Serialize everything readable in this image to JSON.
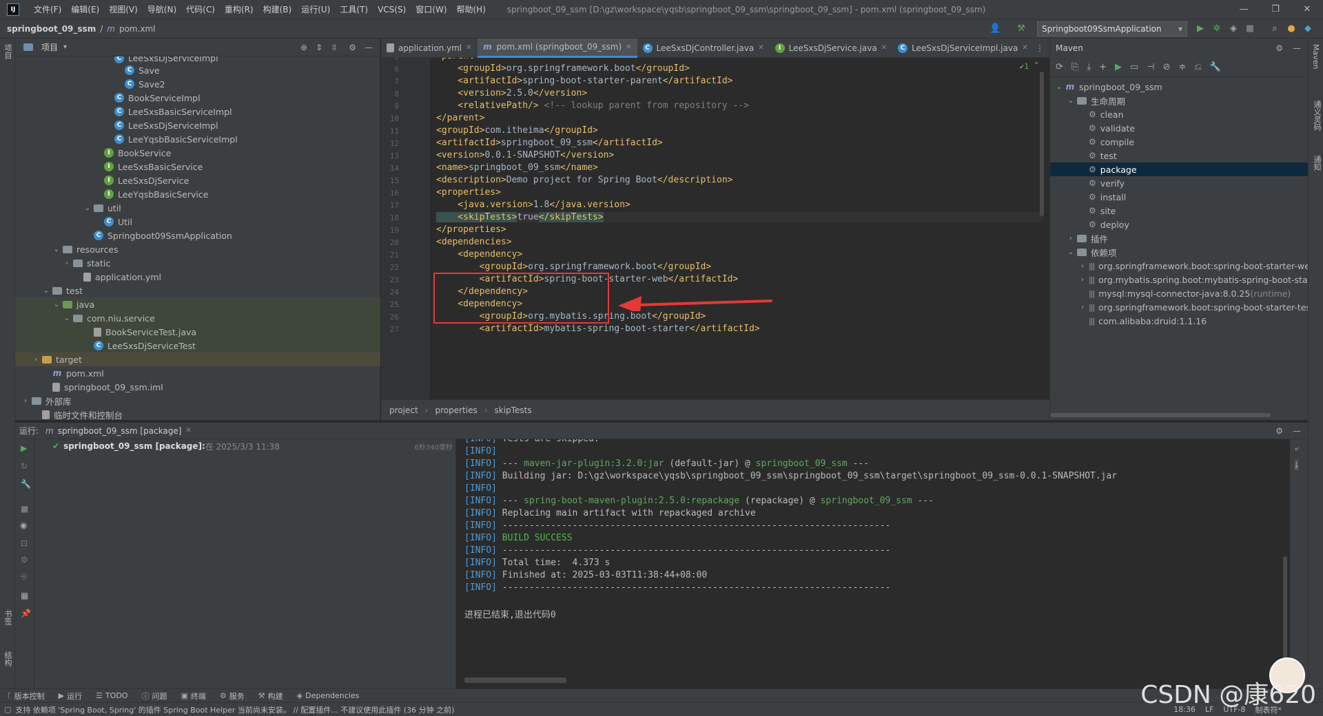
{
  "menubar": {
    "logo": "IJ",
    "items": [
      "文件(F)",
      "编辑(E)",
      "视图(V)",
      "导航(N)",
      "代码(C)",
      "重构(R)",
      "构建(B)",
      "运行(U)",
      "工具(T)",
      "VCS(S)",
      "窗口(W)",
      "帮助(H)"
    ],
    "window_title": "springboot_09_ssm [D:\\gz\\workspace\\yqsb\\springboot_09_ssm\\springboot_09_ssm] - pom.xml (springboot_09_ssm)"
  },
  "navbar": {
    "project": "springboot_09_ssm",
    "file": "pom.xml",
    "run_config": "Springboot09SsmApplication"
  },
  "left_stripe": {
    "project_label": "项目",
    "bookmarks_label": "书签",
    "structure_label": "结构"
  },
  "right_stripe": {
    "maven_label": "Maven",
    "db_label": "通义灵码",
    "notify_label": "通知"
  },
  "project_panel": {
    "title": "项目",
    "rows": [
      {
        "label": "LeeSxsDjServiceImpl",
        "indent": 8,
        "icon": "c",
        "partial": true
      },
      {
        "label": "Save",
        "indent": 9,
        "icon": "c"
      },
      {
        "label": "Save2",
        "indent": 9,
        "icon": "c"
      },
      {
        "label": "BookServiceImpl",
        "indent": 8,
        "icon": "c"
      },
      {
        "label": "LeeSxsBasicServiceImpl",
        "indent": 8,
        "icon": "c"
      },
      {
        "label": "LeeSxsDjServiceImpl",
        "indent": 8,
        "icon": "c"
      },
      {
        "label": "LeeYqsbBasicServiceImpl",
        "indent": 8,
        "icon": "c"
      },
      {
        "label": "BookService",
        "indent": 7,
        "icon": "i"
      },
      {
        "label": "LeeSxsBasicService",
        "indent": 7,
        "icon": "i"
      },
      {
        "label": "LeeSxsDjService",
        "indent": 7,
        "icon": "i"
      },
      {
        "label": "LeeYqsbBasicService",
        "indent": 7,
        "icon": "i"
      },
      {
        "label": "util",
        "indent": 6,
        "icon": "f",
        "chev": "v"
      },
      {
        "label": "Util",
        "indent": 7,
        "icon": "c"
      },
      {
        "label": "Springboot09SsmApplication",
        "indent": 6,
        "icon": "c"
      },
      {
        "label": "resources",
        "indent": 3,
        "icon": "f",
        "chev": "v"
      },
      {
        "label": "static",
        "indent": 4,
        "icon": "f",
        "chev": ">"
      },
      {
        "label": "application.yml",
        "indent": 5,
        "icon": "x"
      },
      {
        "label": "test",
        "indent": 2,
        "icon": "f",
        "chev": "v"
      },
      {
        "label": "java",
        "indent": 3,
        "icon": "fg",
        "chev": "v",
        "hl": "g"
      },
      {
        "label": "com.niu.service",
        "indent": 4,
        "icon": "f",
        "chev": "v",
        "hl": "g"
      },
      {
        "label": "BookServiceTest.java",
        "indent": 6,
        "icon": "x",
        "hl": "g"
      },
      {
        "label": "LeeSxsDjServiceTest",
        "indent": 6,
        "icon": "c",
        "hl": "g"
      },
      {
        "label": "target",
        "indent": 1,
        "icon": "fy",
        "chev": ">",
        "hl": "y"
      },
      {
        "label": "pom.xml",
        "indent": 2,
        "icon": "m"
      },
      {
        "label": "springboot_09_ssm.iml",
        "indent": 2,
        "icon": "x"
      },
      {
        "label": "外部库",
        "indent": 0,
        "icon": "lib",
        "chev": ">"
      },
      {
        "label": "临时文件和控制台",
        "indent": 1,
        "icon": "x"
      }
    ]
  },
  "tabs": [
    {
      "label": "application.yml",
      "icon": "x",
      "active": false
    },
    {
      "label": "pom.xml (springboot_09_ssm)",
      "icon": "m",
      "active": true
    },
    {
      "label": "LeeSxsDjController.java",
      "icon": "c",
      "active": false
    },
    {
      "label": "LeeSxsDjService.java",
      "icon": "i",
      "active": false
    },
    {
      "label": "LeeSxsDjServiceImpl.java",
      "icon": "c",
      "active": false
    }
  ],
  "editor": {
    "inspection": "✔1",
    "lines": [
      {
        "n": "5",
        "code": [
          [
            "tag",
            "<parent>"
          ]
        ]
      },
      {
        "n": "6",
        "code": [
          [
            "tag",
            "    <groupId>"
          ],
          [
            "txt",
            "org.springframework.boot"
          ],
          [
            "tag",
            "</groupId>"
          ]
        ]
      },
      {
        "n": "7",
        "code": [
          [
            "tag",
            "    <artifactId>"
          ],
          [
            "txt",
            "spring-boot-starter-parent"
          ],
          [
            "tag",
            "</artifactId>"
          ]
        ]
      },
      {
        "n": "8",
        "code": [
          [
            "tag",
            "    <version>"
          ],
          [
            "txt",
            "2.5.0"
          ],
          [
            "tag",
            "</version>"
          ]
        ]
      },
      {
        "n": "9",
        "code": [
          [
            "tag",
            "    <relativePath/>"
          ],
          [
            "cmt",
            " <!-- lookup parent from repository -->"
          ]
        ]
      },
      {
        "n": "10",
        "code": [
          [
            "tag",
            "</parent>"
          ]
        ]
      },
      {
        "n": "11",
        "code": [
          [
            "tag",
            "<groupId>"
          ],
          [
            "txt",
            "com.itheima"
          ],
          [
            "tag",
            "</groupId>"
          ]
        ]
      },
      {
        "n": "12",
        "code": [
          [
            "tag",
            "<artifactId>"
          ],
          [
            "txt",
            "springboot_09_ssm"
          ],
          [
            "tag",
            "</artifactId>"
          ]
        ]
      },
      {
        "n": "13",
        "code": [
          [
            "tag",
            "<version>"
          ],
          [
            "txt",
            "0.0.1-SNAPSHOT"
          ],
          [
            "tag",
            "</version>"
          ]
        ]
      },
      {
        "n": "14",
        "code": [
          [
            "tag",
            "<name>"
          ],
          [
            "txt",
            "springboot_09_ssm"
          ],
          [
            "tag",
            "</name>"
          ]
        ]
      },
      {
        "n": "15",
        "code": [
          [
            "tag",
            "<description>"
          ],
          [
            "txt",
            "Demo project for Spring Boot"
          ],
          [
            "tag",
            "</description>"
          ]
        ]
      },
      {
        "n": "16",
        "code": [
          [
            "tag",
            "<properties>"
          ]
        ]
      },
      {
        "n": "17",
        "code": [
          [
            "tag",
            "    <java.version>"
          ],
          [
            "txt",
            "1.8"
          ],
          [
            "tag",
            "</java.version>"
          ]
        ]
      },
      {
        "n": "18",
        "code": [
          [
            "tag",
            "    <skipTests>"
          ],
          [
            "txt",
            "true"
          ],
          [
            "tag",
            "</skipTests>"
          ]
        ]
      },
      {
        "n": "19",
        "code": [
          [
            "tag",
            "</properties>"
          ]
        ]
      },
      {
        "n": "20",
        "code": [
          [
            "tag",
            "<dependencies>"
          ]
        ]
      },
      {
        "n": "21",
        "code": [
          [
            "tag",
            "    <dependency>"
          ]
        ]
      },
      {
        "n": "22",
        "code": [
          [
            "tag",
            "        <groupId>"
          ],
          [
            "txt",
            "org.springframework.boot"
          ],
          [
            "tag",
            "</groupId>"
          ]
        ]
      },
      {
        "n": "23",
        "code": [
          [
            "tag",
            "        <artifactId>"
          ],
          [
            "txt",
            "spring-boot-starter-web"
          ],
          [
            "tag",
            "</artifactId>"
          ]
        ]
      },
      {
        "n": "24",
        "code": [
          [
            "tag",
            "    </dependency>"
          ]
        ]
      },
      {
        "n": "25",
        "code": [
          [
            "tag",
            "    <dependency>"
          ]
        ]
      },
      {
        "n": "26",
        "code": [
          [
            "tag",
            "        <groupId>"
          ],
          [
            "txt",
            "org.mybatis.spring.boot"
          ],
          [
            "tag",
            "</groupId>"
          ]
        ]
      },
      {
        "n": "27",
        "code": [
          [
            "tag",
            "        <artifactId>"
          ],
          [
            "txt",
            "mybatis-spring-boot-starter"
          ],
          [
            "tag",
            "</artifactId>"
          ]
        ]
      }
    ]
  },
  "breadcrumb": [
    "project",
    "properties",
    "skipTests"
  ],
  "maven": {
    "title": "Maven",
    "rows": [
      {
        "label": "springboot_09_ssm",
        "indent": 0,
        "chev": "v",
        "icon": "m"
      },
      {
        "label": "生命周期",
        "indent": 1,
        "chev": "v",
        "icon": "f"
      },
      {
        "label": "clean",
        "indent": 2,
        "icon": "gear"
      },
      {
        "label": "validate",
        "indent": 2,
        "icon": "gear"
      },
      {
        "label": "compile",
        "indent": 2,
        "icon": "gear"
      },
      {
        "label": "test",
        "indent": 2,
        "icon": "gear"
      },
      {
        "label": "package",
        "indent": 2,
        "icon": "gear",
        "sel": true
      },
      {
        "label": "verify",
        "indent": 2,
        "icon": "gear"
      },
      {
        "label": "install",
        "indent": 2,
        "icon": "gear"
      },
      {
        "label": "site",
        "indent": 2,
        "icon": "gear"
      },
      {
        "label": "deploy",
        "indent": 2,
        "icon": "gear"
      },
      {
        "label": "插件",
        "indent": 1,
        "chev": ">",
        "icon": "f"
      },
      {
        "label": "依赖项",
        "indent": 1,
        "chev": "v",
        "icon": "f"
      },
      {
        "label": "org.springframework.boot:spring-boot-starter-web",
        "indent": 2,
        "chev": ">",
        "icon": "lib"
      },
      {
        "label": "org.mybatis.spring.boot:mybatis-spring-boot-starte",
        "indent": 2,
        "chev": ">",
        "icon": "lib"
      },
      {
        "label": "mysql:mysql-connector-java:8.0.25",
        "suffix": " (runtime)",
        "indent": 2,
        "icon": "lib"
      },
      {
        "label": "org.springframework.boot:spring-boot-starter-test:",
        "indent": 2,
        "chev": ">",
        "icon": "lib"
      },
      {
        "label": "com.alibaba:druid:1.1.16",
        "indent": 2,
        "icon": "lib"
      }
    ]
  },
  "run": {
    "label": "运行:",
    "tab": "springboot_09_ssm [package]",
    "tree_item": "springboot_09_ssm [package]:",
    "tree_time": " 在 2025/3/3 11:38",
    "duration": "6秒340毫秒",
    "console": [
      [
        [
          "info",
          "[INFO]"
        ],
        [
          "plain",
          " Tests are skipped."
        ]
      ],
      [
        [
          "info",
          "[INFO]"
        ]
      ],
      [
        [
          "info",
          "[INFO]"
        ],
        [
          "plain",
          " --- "
        ],
        [
          "grn2",
          "maven-jar-plugin:3.2.0:jar"
        ],
        [
          "plain",
          " (default-jar) @ "
        ],
        [
          "grn2",
          "springboot_09_ssm"
        ],
        [
          "plain",
          " ---"
        ]
      ],
      [
        [
          "info",
          "[INFO]"
        ],
        [
          "plain",
          " Building jar: D:\\gz\\workspace\\yqsb\\springboot_09_ssm\\springboot_09_ssm\\target\\springboot_09_ssm-0.0.1-SNAPSHOT.jar"
        ]
      ],
      [
        [
          "info",
          "[INFO]"
        ]
      ],
      [
        [
          "info",
          "[INFO]"
        ],
        [
          "plain",
          " --- "
        ],
        [
          "grn2",
          "spring-boot-maven-plugin:2.5.0:repackage"
        ],
        [
          "plain",
          " (repackage) @ "
        ],
        [
          "grn2",
          "springboot_09_ssm"
        ],
        [
          "plain",
          " ---"
        ]
      ],
      [
        [
          "info",
          "[INFO]"
        ],
        [
          "plain",
          " Replacing main artifact with repackaged archive"
        ]
      ],
      [
        [
          "info",
          "[INFO]"
        ],
        [
          "plain",
          " ------------------------------------------------------------------------"
        ]
      ],
      [
        [
          "info",
          "[INFO]"
        ],
        [
          "green",
          " BUILD SUCCESS"
        ]
      ],
      [
        [
          "info",
          "[INFO]"
        ],
        [
          "plain",
          " ------------------------------------------------------------------------"
        ]
      ],
      [
        [
          "info",
          "[INFO]"
        ],
        [
          "plain",
          " Total time:  4.373 s"
        ]
      ],
      [
        [
          "info",
          "[INFO]"
        ],
        [
          "plain",
          " Finished at: 2025-03-03T11:38:44+08:00"
        ]
      ],
      [
        [
          "info",
          "[INFO]"
        ],
        [
          "plain",
          " ------------------------------------------------------------------------"
        ]
      ],
      [],
      [
        [
          "plain",
          "进程已结束,退出代码0"
        ]
      ]
    ]
  },
  "bottom_tabs": [
    "版本控制",
    "运行",
    "TODO",
    "问题",
    "终端",
    "服务",
    "构建",
    "Dependencies"
  ],
  "status": {
    "message": "支持 依赖项 'Spring Boot, Spring' 的插件 Spring Boot Helper 当前尚未安装。 // 配置插件...   不建议使用此插件 (36 分钟 之前)",
    "position": "18:36",
    "line_sep": "LF",
    "encoding": "UTF-8",
    "indent": "制表符*"
  },
  "watermark": "CSDN @康620"
}
